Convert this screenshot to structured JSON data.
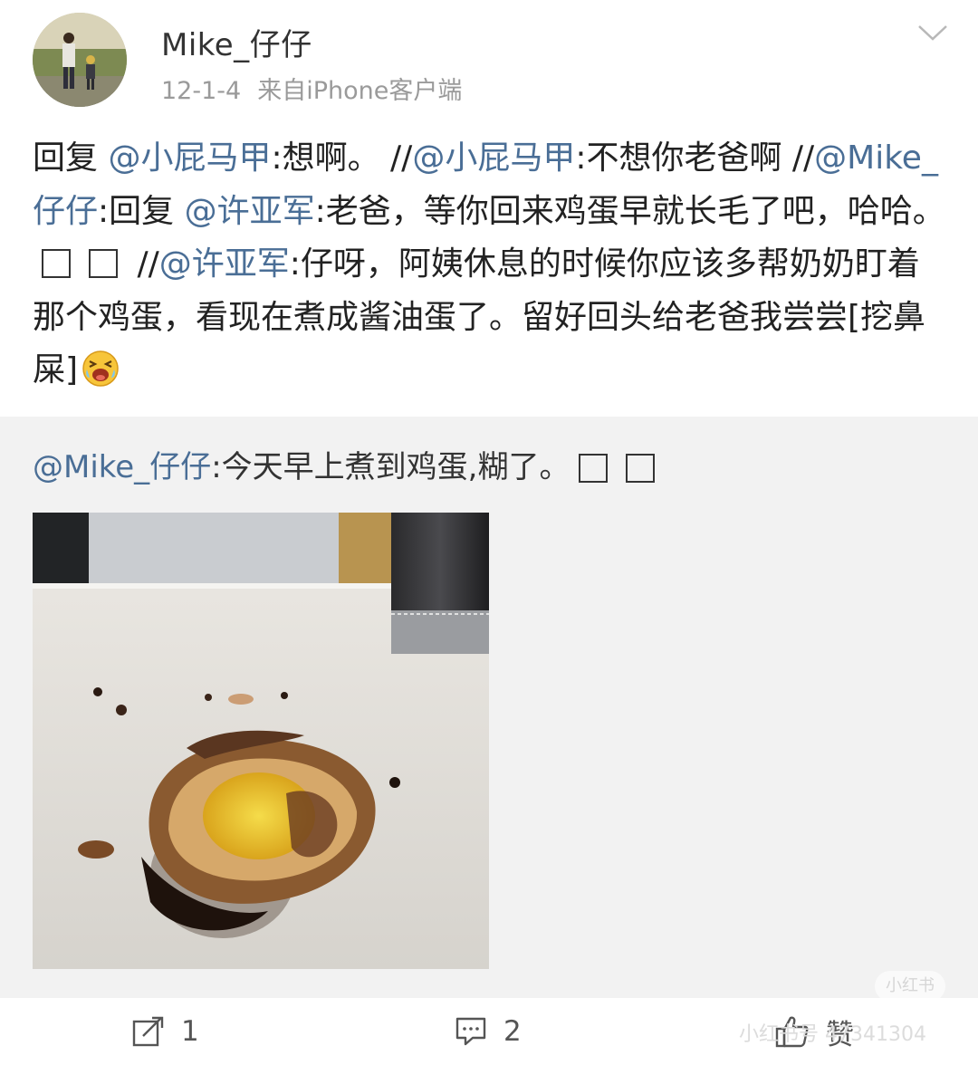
{
  "post": {
    "username": "Mike_仔仔",
    "date": "12-1-4",
    "source": "来自iPhone客户端",
    "body": [
      {
        "t": "text",
        "v": "回复 "
      },
      {
        "t": "mention",
        "v": "@小屁马甲"
      },
      {
        "t": "text",
        "v": ":想啊。 //"
      },
      {
        "t": "mention",
        "v": "@小屁马甲"
      },
      {
        "t": "text",
        "v": ":不想你老爸啊 //"
      },
      {
        "t": "mention",
        "v": "@Mike_仔仔"
      },
      {
        "t": "text",
        "v": ":回复 "
      },
      {
        "t": "mention",
        "v": "@许亚军"
      },
      {
        "t": "text",
        "v": ":老爸，等你回来鸡蛋早就长毛了吧，哈哈。"
      },
      {
        "t": "box"
      },
      {
        "t": "box"
      },
      {
        "t": "text",
        "v": " //"
      },
      {
        "t": "mention",
        "v": "@许亚军"
      },
      {
        "t": "text",
        "v": ":仔呀，阿姨休息的时候你应该多帮奶奶盯着那个鸡蛋，看现在煮成酱油蛋了。留好回头给老爸我尝尝[挖鼻屎]"
      },
      {
        "t": "emoji",
        "icon": "laughing-crying-emoji-icon"
      }
    ]
  },
  "repost": {
    "mention": "@Mike_仔仔",
    "text": ":今天早上煮到鸡蛋,糊了。",
    "image_icon": "burnt-egg-photo"
  },
  "actions": {
    "repost_count": "1",
    "comment_count": "2",
    "like_label": "赞"
  },
  "watermark": {
    "pill": "小红书",
    "text": "小红书号 47341304"
  },
  "colors": {
    "mention": "#4a6e96",
    "repost_bg": "#f2f2f2",
    "meta": "#9a9a9a"
  }
}
